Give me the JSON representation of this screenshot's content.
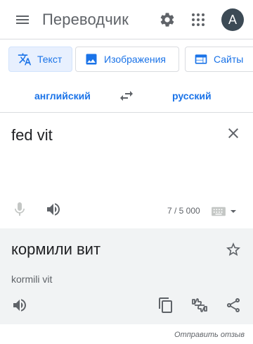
{
  "header": {
    "app_title": "Переводчик",
    "avatar_letter": "A",
    "icons": [
      "menu-icon",
      "gear-icon",
      "apps-grid-icon"
    ]
  },
  "tabs": [
    {
      "label": "Текст",
      "icon": "translate-icon",
      "active": true
    },
    {
      "label": "Изображения",
      "icon": "image-icon",
      "active": false
    },
    {
      "label": "Сайты",
      "icon": "website-icon",
      "active": false
    }
  ],
  "languages": {
    "source": "английский",
    "target": "русский"
  },
  "source": {
    "text": "fed vit",
    "char_count": "7 / 5 000"
  },
  "result": {
    "text": "кормили вит",
    "transliteration": "kormili vit"
  },
  "footer": {
    "feedback_link": "Отправить отзыв"
  },
  "colors": {
    "accent": "#1a73e8",
    "active_tab_bg": "#e8f0fe",
    "result_bg": "#f1f3f4",
    "icon_gray": "#5f6368",
    "avatar_bg": "#3c4a55"
  }
}
